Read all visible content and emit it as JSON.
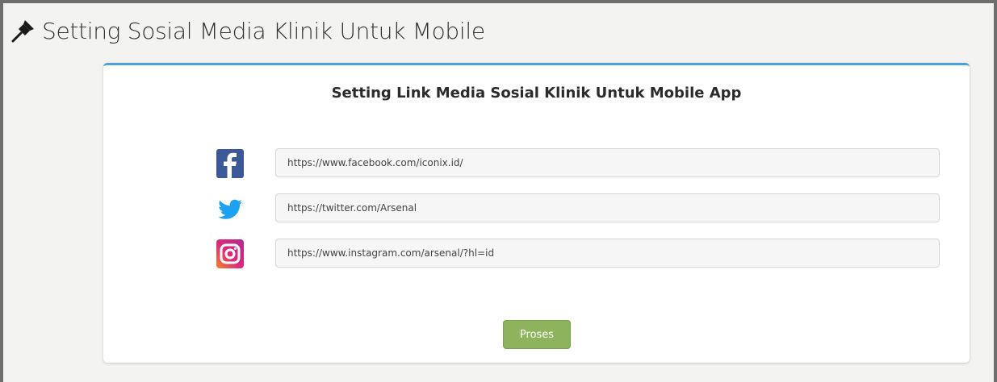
{
  "header": {
    "title": "Setting Sosial Media Klinik Untuk Mobile",
    "icon": "pin-icon"
  },
  "card": {
    "title": "Setting Link Media Sosial Klinik Untuk Mobile App",
    "accent_color": "#4aa3df"
  },
  "social_links": [
    {
      "icon": "facebook-icon",
      "value": "https://www.facebook.com/iconix.id/",
      "color": "#3b5998"
    },
    {
      "icon": "twitter-icon",
      "value": "https://twitter.com/Arsenal",
      "color": "#1da1f2"
    },
    {
      "icon": "instagram-icon",
      "value": "https://www.instagram.com/arsenal/?hl=id",
      "color": "#e4405f"
    }
  ],
  "submit_button": {
    "label": "Proses",
    "color": "#8db35d"
  }
}
